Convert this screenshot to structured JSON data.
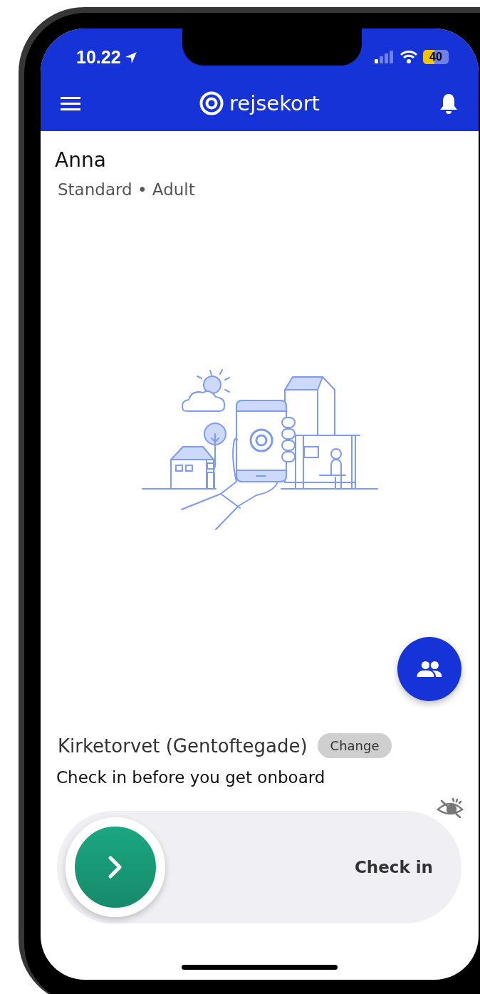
{
  "status_bar": {
    "time": "10.22",
    "battery": "40"
  },
  "header": {
    "logo": "rejsekort"
  },
  "profile": {
    "name": "Anna",
    "subtitle": "Standard • Adult"
  },
  "location": {
    "name": "Kirketorvet (Gentoftegade)",
    "change_button": "Change"
  },
  "instruction": "Check in before you get onboard",
  "check_in_slider": {
    "label": "Check in",
    "level": 0
  }
}
